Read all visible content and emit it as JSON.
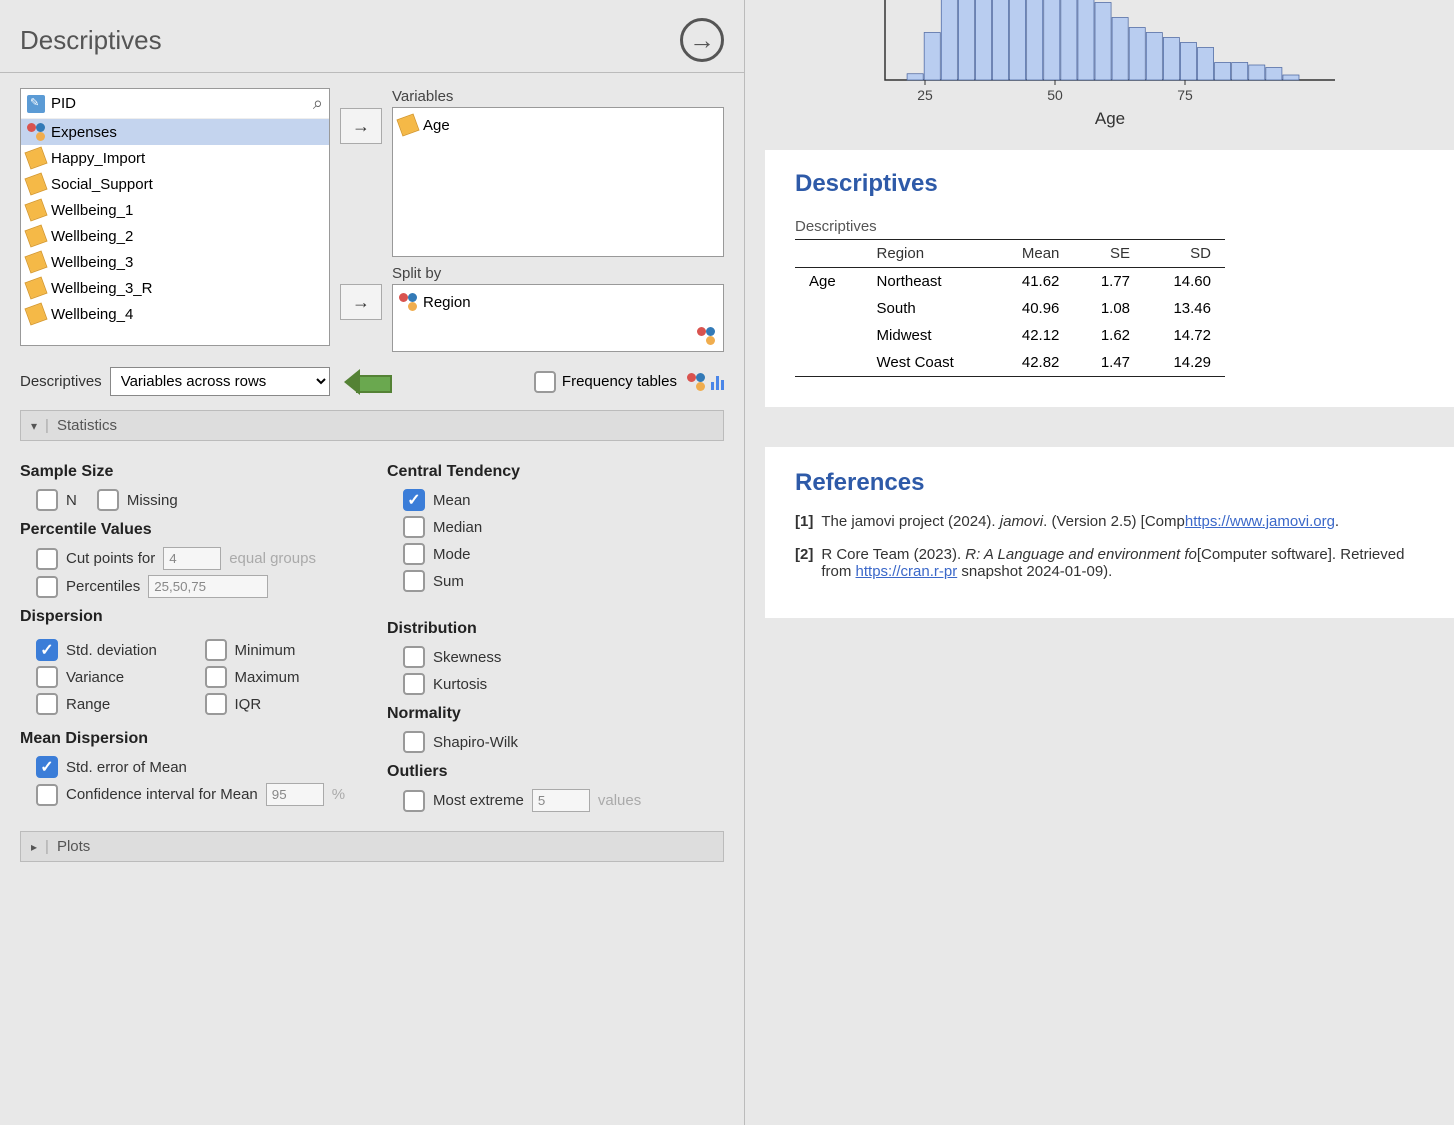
{
  "header": {
    "title": "Descriptives"
  },
  "var_list": [
    {
      "name": "PID",
      "type": "id"
    },
    {
      "name": "Expenses",
      "type": "nominal",
      "selected": true
    },
    {
      "name": "Happy_Import",
      "type": "continuous"
    },
    {
      "name": "Social_Support",
      "type": "continuous"
    },
    {
      "name": "Wellbeing_1",
      "type": "continuous"
    },
    {
      "name": "Wellbeing_2",
      "type": "continuous"
    },
    {
      "name": "Wellbeing_3",
      "type": "continuous"
    },
    {
      "name": "Wellbeing_3_R",
      "type": "continuous"
    },
    {
      "name": "Wellbeing_4",
      "type": "continuous"
    }
  ],
  "targets": {
    "variables_label": "Variables",
    "variables": [
      {
        "name": "Age",
        "type": "continuous"
      }
    ],
    "splitby_label": "Split by",
    "splitby": [
      {
        "name": "Region",
        "type": "nominal"
      }
    ]
  },
  "controls": {
    "desc_label": "Descriptives",
    "layout_value": "Variables across rows",
    "freq_label": "Frequency tables"
  },
  "sections": {
    "statistics": "Statistics",
    "plots": "Plots"
  },
  "stats": {
    "sample_size": "Sample Size",
    "n": "N",
    "missing": "Missing",
    "percentile_values": "Percentile Values",
    "cut_points": "Cut points for",
    "cut_points_val": "4",
    "equal_groups": "equal groups",
    "percentiles": "Percentiles",
    "percentiles_val": "25,50,75",
    "dispersion": "Dispersion",
    "std_dev": "Std. deviation",
    "variance": "Variance",
    "range": "Range",
    "minimum": "Minimum",
    "maximum": "Maximum",
    "iqr": "IQR",
    "mean_dispersion": "Mean Dispersion",
    "std_error": "Std. error of Mean",
    "ci": "Confidence interval for Mean",
    "ci_val": "95",
    "ci_unit": "%",
    "central_tendency": "Central Tendency",
    "mean": "Mean",
    "median": "Median",
    "mode": "Mode",
    "sum": "Sum",
    "distribution": "Distribution",
    "skewness": "Skewness",
    "kurtosis": "Kurtosis",
    "normality": "Normality",
    "shapiro": "Shapiro-Wilk",
    "outliers": "Outliers",
    "most_extreme": "Most extreme",
    "most_extreme_val": "5",
    "values": "values"
  },
  "results": {
    "title": "Descriptives",
    "table_caption": "Descriptives",
    "headers": {
      "region": "Region",
      "mean": "Mean",
      "se": "SE",
      "sd": "SD"
    },
    "var": "Age",
    "rows": [
      {
        "region": "Northeast",
        "mean": "41.62",
        "se": "1.77",
        "sd": "14.60"
      },
      {
        "region": "South",
        "mean": "40.96",
        "se": "1.08",
        "sd": "13.46"
      },
      {
        "region": "Midwest",
        "mean": "42.12",
        "se": "1.62",
        "sd": "14.72"
      },
      {
        "region": "West Coast",
        "mean": "42.82",
        "se": "1.47",
        "sd": "14.29"
      }
    ]
  },
  "chart_data": {
    "type": "bar",
    "xlabel": "Age",
    "x_ticks": [
      25,
      50,
      75
    ],
    "values": [
      0,
      5,
      38,
      80,
      76,
      82,
      84,
      80,
      82,
      78,
      80,
      70,
      62,
      50,
      42,
      38,
      34,
      30,
      26,
      14,
      14,
      12,
      10,
      4
    ]
  },
  "refs": {
    "title": "References",
    "items": [
      {
        "num": "[1]",
        "text_a": "The jamovi project (2024). ",
        "em": "jamovi",
        "text_b": ". (Version 2.5) [Comp",
        "link": "https://www.jamovi.org",
        "text_c": "."
      },
      {
        "num": "[2]",
        "text_a": "R Core Team (2023). ",
        "em": "R: A Language and environment fo",
        "text_b": "[Computer software]. Retrieved from ",
        "link": "https://cran.r-pr",
        "text_c": " snapshot 2024-01-09)."
      }
    ]
  }
}
